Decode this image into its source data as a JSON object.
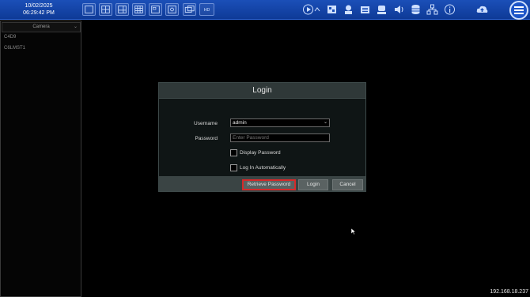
{
  "topbar": {
    "date": "10/02/2025",
    "time": "06:29:42 PM",
    "layout_buttons": [
      "screen-1-icon",
      "screen-4-icon",
      "screen-6-icon",
      "screen-9-icon",
      "screen-16-icon",
      "pip-icon",
      "multi-screen-icon",
      "hd-icon"
    ],
    "layout_hd_label": "HD",
    "right_buttons": [
      "playback-icon",
      "expand-icon",
      "layout-settings-icon",
      "record-icon",
      "snapshot-icon",
      "camera-icon",
      "alarm-icon",
      "audio-icon",
      "disk-icon",
      "network-icon",
      "info-icon",
      "cloud-upload-icon"
    ],
    "menu_icon": "hamburger-menu-icon"
  },
  "sidebar": {
    "dropdown_label": "Camera",
    "items": [
      "C4D9",
      "C6LMST1"
    ]
  },
  "login": {
    "title": "Login",
    "username_label": "Username",
    "username_value": "admin",
    "password_label": "Password",
    "password_placeholder": "Enter Password",
    "display_password_label": "Display Password",
    "auto_login_label": "Log In Automatically",
    "retrieve_label": "Retrieve Password",
    "login_label": "Login",
    "cancel_label": "Cancel"
  },
  "status": {
    "ip": "192.168.18.237"
  },
  "colors": {
    "topbar": "#0e3a97",
    "highlight": "#d62a2a"
  }
}
